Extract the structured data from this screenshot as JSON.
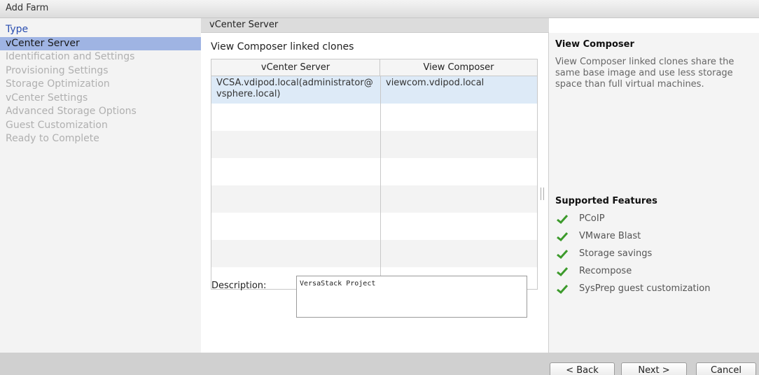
{
  "window": {
    "title": "Add Farm"
  },
  "nav": {
    "items": [
      {
        "label": "Type",
        "state": "done"
      },
      {
        "label": "vCenter Server",
        "state": "active"
      },
      {
        "label": "Identification and Settings",
        "state": "pending"
      },
      {
        "label": "Provisioning Settings",
        "state": "pending"
      },
      {
        "label": "Storage Optimization",
        "state": "pending"
      },
      {
        "label": "vCenter Settings",
        "state": "pending"
      },
      {
        "label": "Advanced Storage Options",
        "state": "pending"
      },
      {
        "label": "Guest Customization",
        "state": "pending"
      },
      {
        "label": "Ready to Complete",
        "state": "pending"
      }
    ]
  },
  "main": {
    "header": "vCenter Server",
    "subtitle": "View Composer linked clones",
    "table": {
      "columns": [
        "vCenter Server",
        "View Composer"
      ],
      "rows": [
        {
          "vcenter": "VCSA.vdipod.local(administrator@vsphere.local)",
          "composer": "viewcom.vdipod.local"
        }
      ]
    },
    "description_label": "Description:",
    "description_value": "VersaStack Project"
  },
  "info": {
    "title": "View Composer",
    "body": "View Composer linked clones share the same base image and use less storage space than full virtual machines.",
    "features_title": "Supported Features",
    "features": [
      "PCoIP",
      "VMware Blast",
      "Storage savings",
      "Recompose",
      "SysPrep guest customization"
    ]
  },
  "footer": {
    "back_label": "< Back",
    "next_label": "Next >",
    "cancel_label": "Cancel"
  },
  "colors": {
    "accent": "#9fb4e3",
    "link": "#2a4eb0",
    "check": "#3c9a2b"
  },
  "icons": {
    "feature_check": "check-icon",
    "splitter": "splitter-grip-icon"
  }
}
